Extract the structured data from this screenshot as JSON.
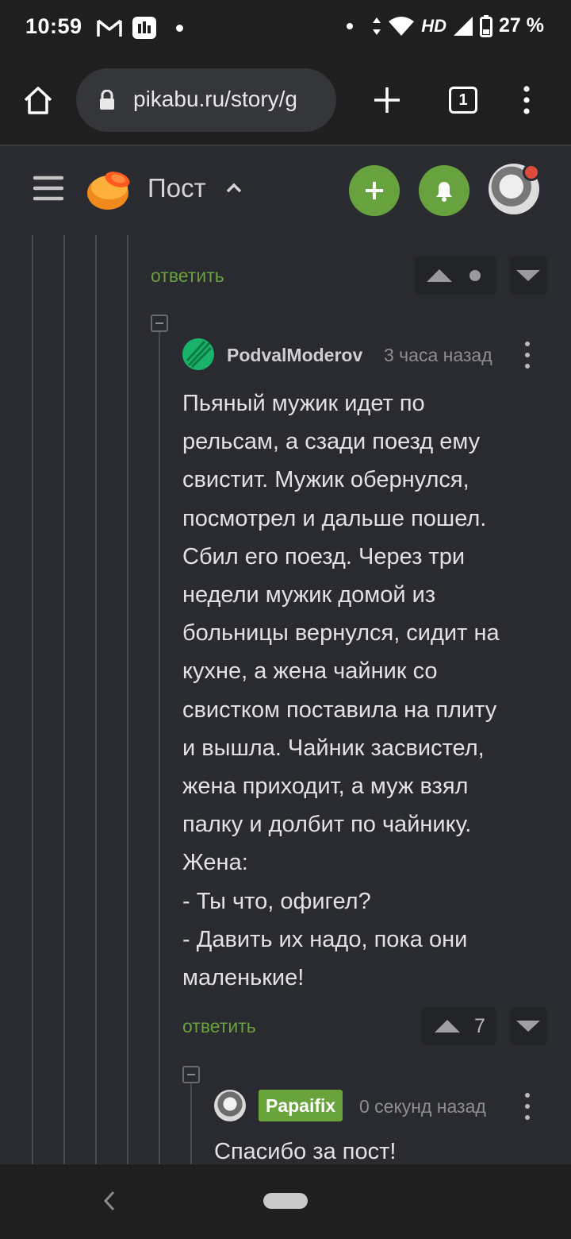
{
  "status_bar": {
    "time": "10:59",
    "network": "HD",
    "battery": "27 %",
    "icons": [
      "gmail-icon",
      "app-icon",
      "dot-icon",
      "data-arrows-icon",
      "wifi-icon",
      "signal-icon",
      "battery-icon"
    ]
  },
  "browser": {
    "url": "pikabu.ru/story/g",
    "tabs_count": "1",
    "icons": [
      "home-icon",
      "lock-icon",
      "new-tab-icon",
      "tabs-icon",
      "menu-icon"
    ]
  },
  "header": {
    "title": "Пост",
    "icons": [
      "hamburger-icon",
      "pikabu-logo",
      "chevron-up-icon",
      "add-icon",
      "bell-icon"
    ]
  },
  "colors": {
    "accent_green": "#67a23f",
    "link_green": "#6aa03b",
    "background": "#2a2b30",
    "bars": "#1f1f1f",
    "notification": "#e04a3c"
  },
  "thread": {
    "prev_reply_label": "ответить",
    "comment": {
      "author": "PodvalModerov",
      "time": "3 часа назад",
      "lines": [
        "Пьяный мужик идет по",
        "рельсам, а сзади поезд ему",
        "свистит. Мужик обернулся,",
        "посмотрел и дальше пошел.",
        "Сбил его поезд. Через три",
        "недели мужик домой из",
        "больницы вернулся, сидит на",
        "кухне, а жена чайник со",
        "свистком поставила на плиту",
        "и вышла. Чайник засвистел,",
        "жена приходит, а муж взял",
        "палку и долбит по чайнику.",
        "Жена:",
        "- Ты что, офигел?",
        "- Давить их надо, пока они",
        "маленькие!"
      ],
      "reply_label": "ответить",
      "rating": "7"
    },
    "reply": {
      "author": "Papaifix",
      "time": "0 секунд назад",
      "text": "Спасибо за пост!"
    }
  }
}
